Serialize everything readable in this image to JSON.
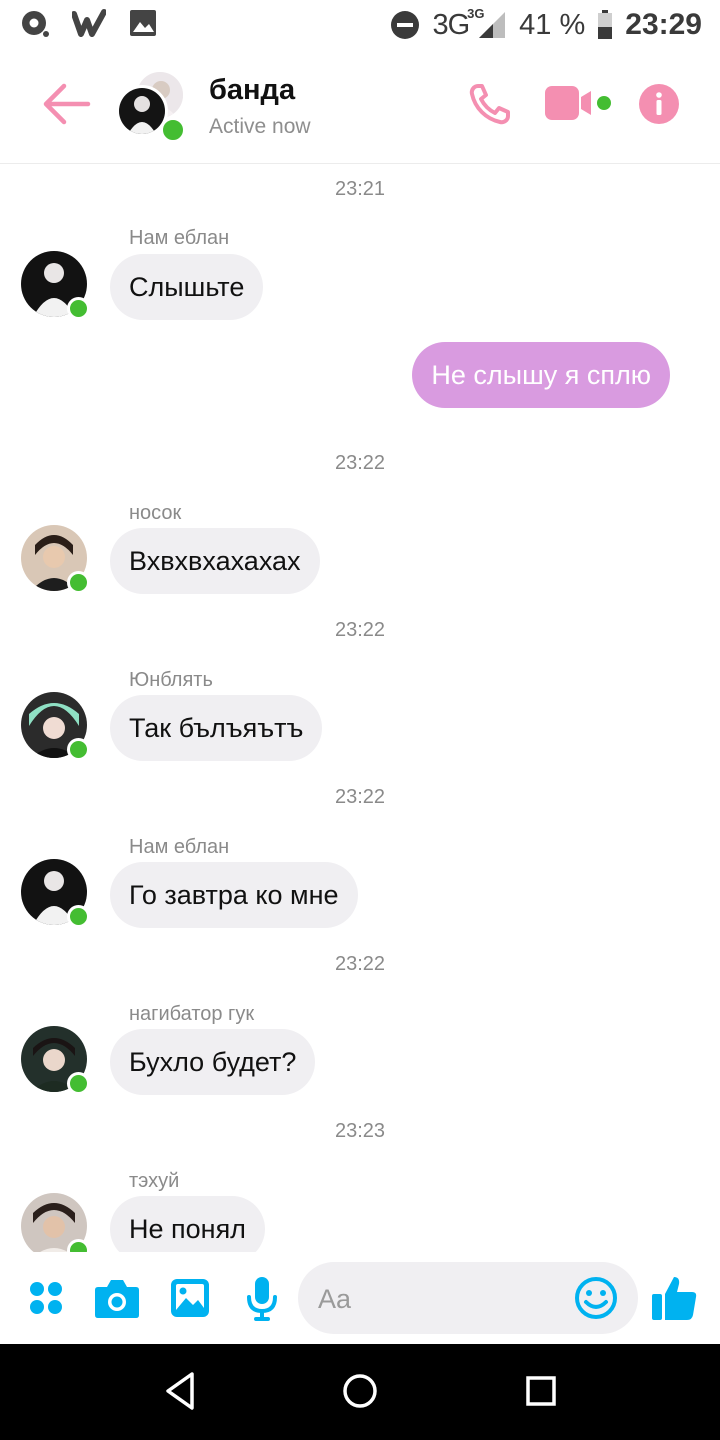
{
  "status_bar": {
    "network": "3G",
    "network_small": "3G",
    "battery": "41 %",
    "time": "23:29",
    "icons": [
      "record-icon",
      "wattpad-icon",
      "image-icon",
      "dnd-icon",
      "signal-icon",
      "battery-icon"
    ]
  },
  "header": {
    "title": "банда",
    "subtitle": "Active now",
    "accent": "#f48fb1",
    "icons": [
      "back-arrow-icon",
      "phone-icon",
      "video-camera-icon",
      "info-icon"
    ]
  },
  "messages": [
    {
      "type": "time",
      "text": "23:21"
    },
    {
      "type": "in",
      "sender": "Нам еблан",
      "text": "Слышьте"
    },
    {
      "type": "out",
      "text": "Не слышу я сплю"
    },
    {
      "type": "time",
      "text": "23:22"
    },
    {
      "type": "in",
      "sender": "носок",
      "text": "Вхвхвхахахах"
    },
    {
      "type": "time",
      "text": "23:22"
    },
    {
      "type": "in",
      "sender": "Юнблять",
      "text": "Так бълъяътъ"
    },
    {
      "type": "time",
      "text": "23:22"
    },
    {
      "type": "in",
      "sender": "Нам еблан",
      "text": "Го завтра ко мне"
    },
    {
      "type": "time",
      "text": "23:22"
    },
    {
      "type": "in",
      "sender": "нагибатор гук",
      "text": "Бухло будет?"
    },
    {
      "type": "time",
      "text": "23:23"
    },
    {
      "type": "in",
      "sender": "тэхуй",
      "text": "Не понял"
    }
  ],
  "composer": {
    "placeholder": "Aa",
    "accent": "#00b2f0",
    "icons": [
      "apps-grid-icon",
      "camera-icon",
      "gallery-icon",
      "microphone-icon",
      "emoji-icon",
      "thumbs-up-icon"
    ]
  },
  "nav": {
    "icons": [
      "back-triangle-icon",
      "home-circle-icon",
      "recents-square-icon"
    ]
  },
  "colors": {
    "incoming_bubble": "#f0eff2",
    "outgoing_bubble": "#d99be0",
    "online_dot": "#44bd32"
  }
}
